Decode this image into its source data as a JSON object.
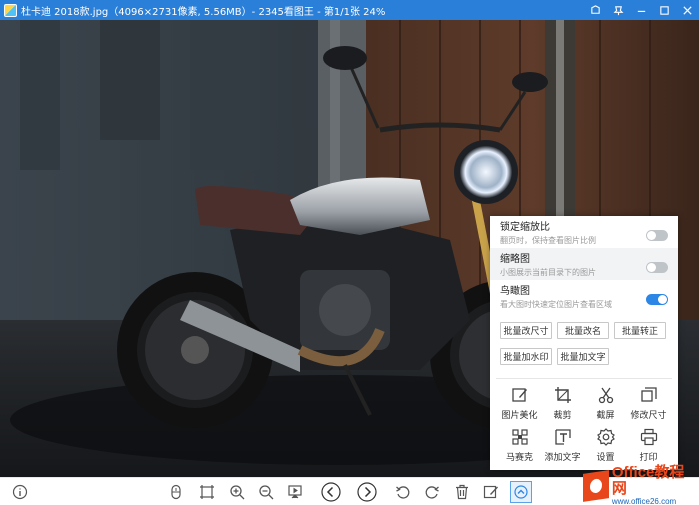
{
  "window": {
    "title": "杜卡迪 2018款.jpg（4096×2731像素, 5.56MB）- 2345看图王 - 第1/1张 24%",
    "controls": [
      "skin-icon",
      "pin-icon",
      "minimize-icon",
      "maximize-icon",
      "close-icon"
    ]
  },
  "panel": {
    "options": [
      {
        "title": "锁定缩放比",
        "desc": "翻页时，保持查看图片比例",
        "enabled": false
      },
      {
        "title": "缩略图",
        "desc": "小图展示当前目录下的图片",
        "enabled": false
      },
      {
        "title": "鸟瞰图",
        "desc": "看大图时快速定位图片查看区域",
        "enabled": true
      }
    ],
    "batch": [
      "批量改尺寸",
      "批量改名",
      "批量转正",
      "批量加水印",
      "批量加文字"
    ],
    "tools": [
      {
        "label": "图片美化",
        "icon": "edit-icon"
      },
      {
        "label": "裁剪",
        "icon": "crop-icon"
      },
      {
        "label": "截屏",
        "icon": "scissors-icon"
      },
      {
        "label": "修改尺寸",
        "icon": "resize-icon"
      },
      {
        "label": "马赛克",
        "icon": "mosaic-icon"
      },
      {
        "label": "添加文字",
        "icon": "text-icon"
      },
      {
        "label": "设置",
        "icon": "gear-icon"
      },
      {
        "label": "打印",
        "icon": "printer-icon"
      }
    ]
  },
  "toolbar": {
    "buttons": [
      "info-icon",
      "mouse-icon",
      "fit-icon",
      "zoom-in-icon",
      "zoom-out-icon",
      "slideshow-icon",
      "prev-icon",
      "next-icon",
      "rotate-left-icon",
      "rotate-right-icon",
      "delete-icon",
      "edit-icon",
      "more-icon"
    ]
  },
  "watermark": {
    "main": "Office教程网",
    "sub": "www.office26.com"
  },
  "colors": {
    "titlebar": "#2a7fd8",
    "accent": "#2c86e6",
    "watermark": "#e8471b"
  }
}
